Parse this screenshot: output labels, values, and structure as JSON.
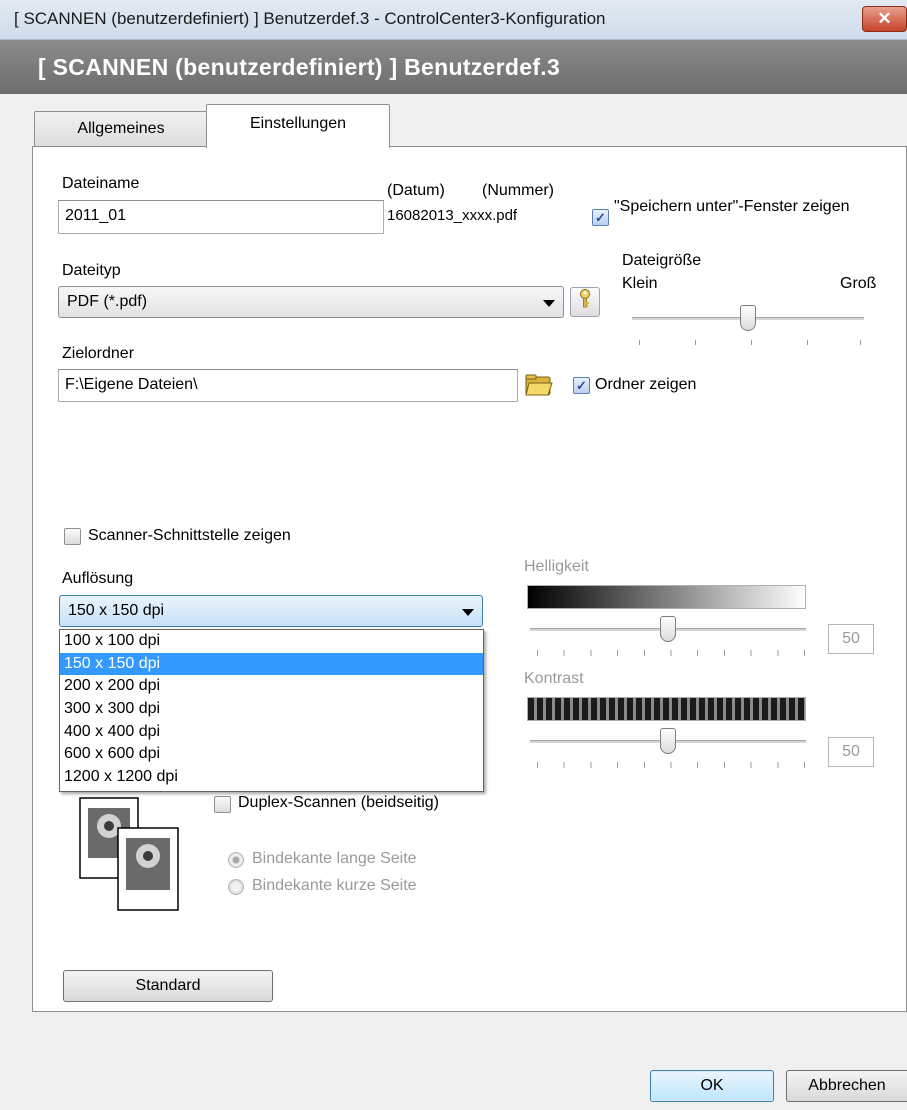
{
  "window": {
    "title": "[ SCANNEN (benutzerdefiniert) ]  Benutzerdef.3 - ControlCenter3-Konfiguration",
    "close_label": "✕",
    "header": "[ SCANNEN (benutzerdefiniert) ]  Benutzerdef.3"
  },
  "tabs": [
    {
      "label": "Allgemeines",
      "active": false
    },
    {
      "label": "Einstellungen",
      "active": true
    }
  ],
  "file": {
    "name_label": "Dateiname",
    "name_value": "2011_01",
    "date_label": "(Datum)",
    "number_label": "(Nummer)",
    "preview": "16082013_xxxx.pdf",
    "save_as_label": "\"Speichern unter\"-Fenster zeigen",
    "save_as_checked": true,
    "type_label": "Dateityp",
    "type_value": "PDF (*.pdf)",
    "size_label": "Dateigröße",
    "size_min_label": "Klein",
    "size_max_label": "Groß",
    "size_level_fraction": 0.5,
    "folder_label": "Zielordner",
    "folder_value": "F:\\Eigene Dateien\\",
    "show_folder_label": "Ordner zeigen",
    "show_folder_checked": true
  },
  "scan": {
    "scanner_ui_label": "Scanner-Schnittstelle zeigen",
    "scanner_ui_checked": false,
    "resolution_label": "Auflösung",
    "resolution_value": "150 x 150 dpi",
    "resolution_options": [
      "100 x 100 dpi",
      "150 x 150 dpi",
      "200 x 200 dpi",
      "300 x 300 dpi",
      "400 x 400 dpi",
      "600 x 600 dpi",
      "1200 x 1200 dpi"
    ],
    "resolution_selected_index": 1,
    "brightness_label": "Helligkeit",
    "brightness_value": "50",
    "contrast_label": "Kontrast",
    "contrast_value": "50",
    "duplex_label": "Duplex-Scannen (beidseitig)",
    "duplex_checked": false,
    "long_edge_label": "Bindekante lange Seite",
    "short_edge_label": "Bindekante kurze Seite"
  },
  "buttons": {
    "default_label": "Standard",
    "ok_label": "OK",
    "cancel_label": "Abbrechen"
  },
  "icons": {
    "key": "key-icon",
    "folder": "folder-open-icon",
    "duplex": "duplex-pages-icon"
  }
}
